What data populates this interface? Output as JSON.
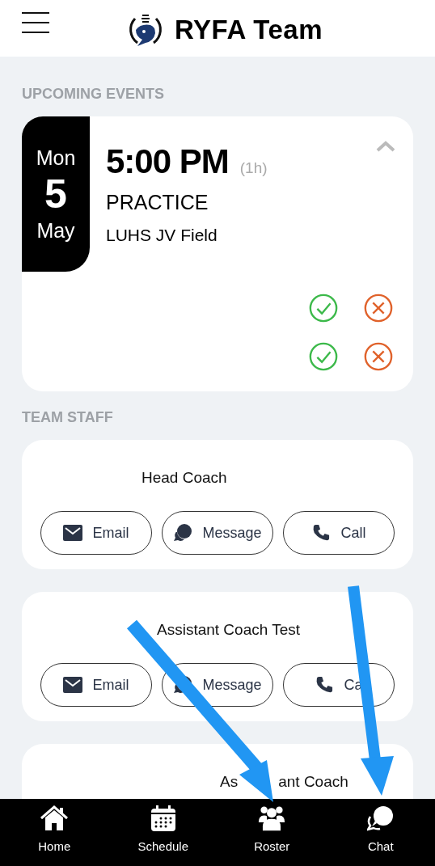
{
  "header": {
    "title": "RYFA Team"
  },
  "upcoming": {
    "heading": "UPCOMING EVENTS",
    "event": {
      "weekday": "Mon",
      "day": "5",
      "month": "May",
      "time": "5:00 PM",
      "duration": "(1h)",
      "type": "PRACTICE",
      "location": "LUHS JV Field",
      "expanded": true,
      "responses": [
        {
          "kind": "response"
        },
        {
          "kind": "response"
        }
      ]
    }
  },
  "staff": {
    "heading": "TEAM STAFF",
    "cards": [
      {
        "title_parts": [
          "Head Coach"
        ],
        "buttons": [
          {
            "kind": "email",
            "label": "Email"
          },
          {
            "kind": "message",
            "label": "Message"
          },
          {
            "kind": "call",
            "label": "Call"
          }
        ]
      },
      {
        "title_parts": [
          "Assistant Coach Test"
        ],
        "buttons": [
          {
            "kind": "email",
            "label": "Email"
          },
          {
            "kind": "message",
            "label": "Message"
          },
          {
            "kind": "call",
            "label": "Ca"
          }
        ]
      },
      {
        "title_parts": [
          "As",
          "ant Coach"
        ]
      }
    ]
  },
  "nav": [
    {
      "kind": "home",
      "label": "Home"
    },
    {
      "kind": "schedule",
      "label": "Schedule"
    },
    {
      "kind": "roster",
      "label": "Roster"
    },
    {
      "kind": "chat",
      "label": "Chat"
    }
  ]
}
